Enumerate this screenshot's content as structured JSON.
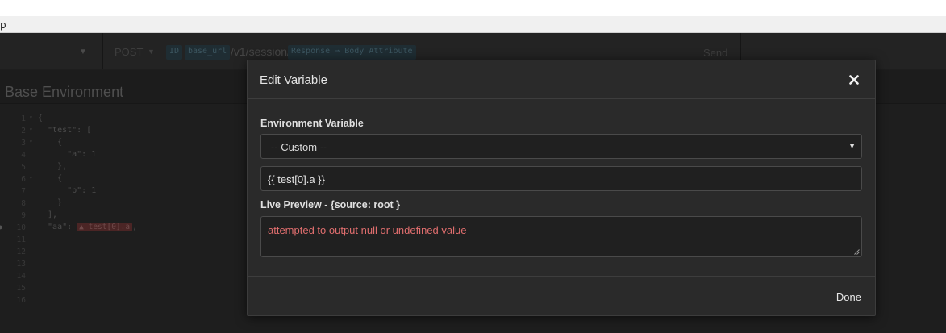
{
  "window": {
    "title_fragment": "p"
  },
  "toolbar": {
    "method": "POST",
    "url_tag_1": "ID",
    "url_tag_2": "base_url",
    "url_path": "/v1/session/",
    "url_tag_3": "Response ⇒ Body Attribute",
    "send_label": "Send"
  },
  "environment": {
    "title": "Base Environment",
    "code_lines": [
      {
        "n": "1",
        "fold": true,
        "text": "{"
      },
      {
        "n": "2",
        "fold": true,
        "text": "  \"test\": ["
      },
      {
        "n": "3",
        "fold": true,
        "text": "    {"
      },
      {
        "n": "4",
        "fold": false,
        "text": "      \"a\": 1"
      },
      {
        "n": "5",
        "fold": false,
        "text": "    },"
      },
      {
        "n": "6",
        "fold": true,
        "text": "    {"
      },
      {
        "n": "7",
        "fold": false,
        "text": "      \"b\": 1"
      },
      {
        "n": "8",
        "fold": false,
        "text": "    }"
      },
      {
        "n": "9",
        "fold": false,
        "text": "  ],"
      },
      {
        "n": "10",
        "fold": false,
        "text": "  \"aa\": ",
        "tag": "▲ test[0].a",
        "after": ","
      },
      {
        "n": "11",
        "fold": false,
        "text": ""
      },
      {
        "n": "12",
        "fold": false,
        "text": ""
      },
      {
        "n": "13",
        "fold": false,
        "text": ""
      },
      {
        "n": "14",
        "fold": false,
        "text": ""
      },
      {
        "n": "15",
        "fold": false,
        "text": ""
      },
      {
        "n": "16",
        "fold": false,
        "text": ""
      }
    ]
  },
  "modal": {
    "title": "Edit Variable",
    "env_var_label": "Environment Variable",
    "select_value": "-- Custom --",
    "template_value": "{{ test[0].a }}",
    "preview_label": "Live Preview - {source: root }",
    "preview_text": "attempted to output null or undefined value",
    "done_label": "Done"
  },
  "colors": {
    "modal_bg": "#2a2a2a",
    "error_text": "#e06e6e",
    "app_bg": "#1e1e1e"
  },
  "icons": {
    "close": "close-icon",
    "select_arrow": "caret-down-icon"
  }
}
